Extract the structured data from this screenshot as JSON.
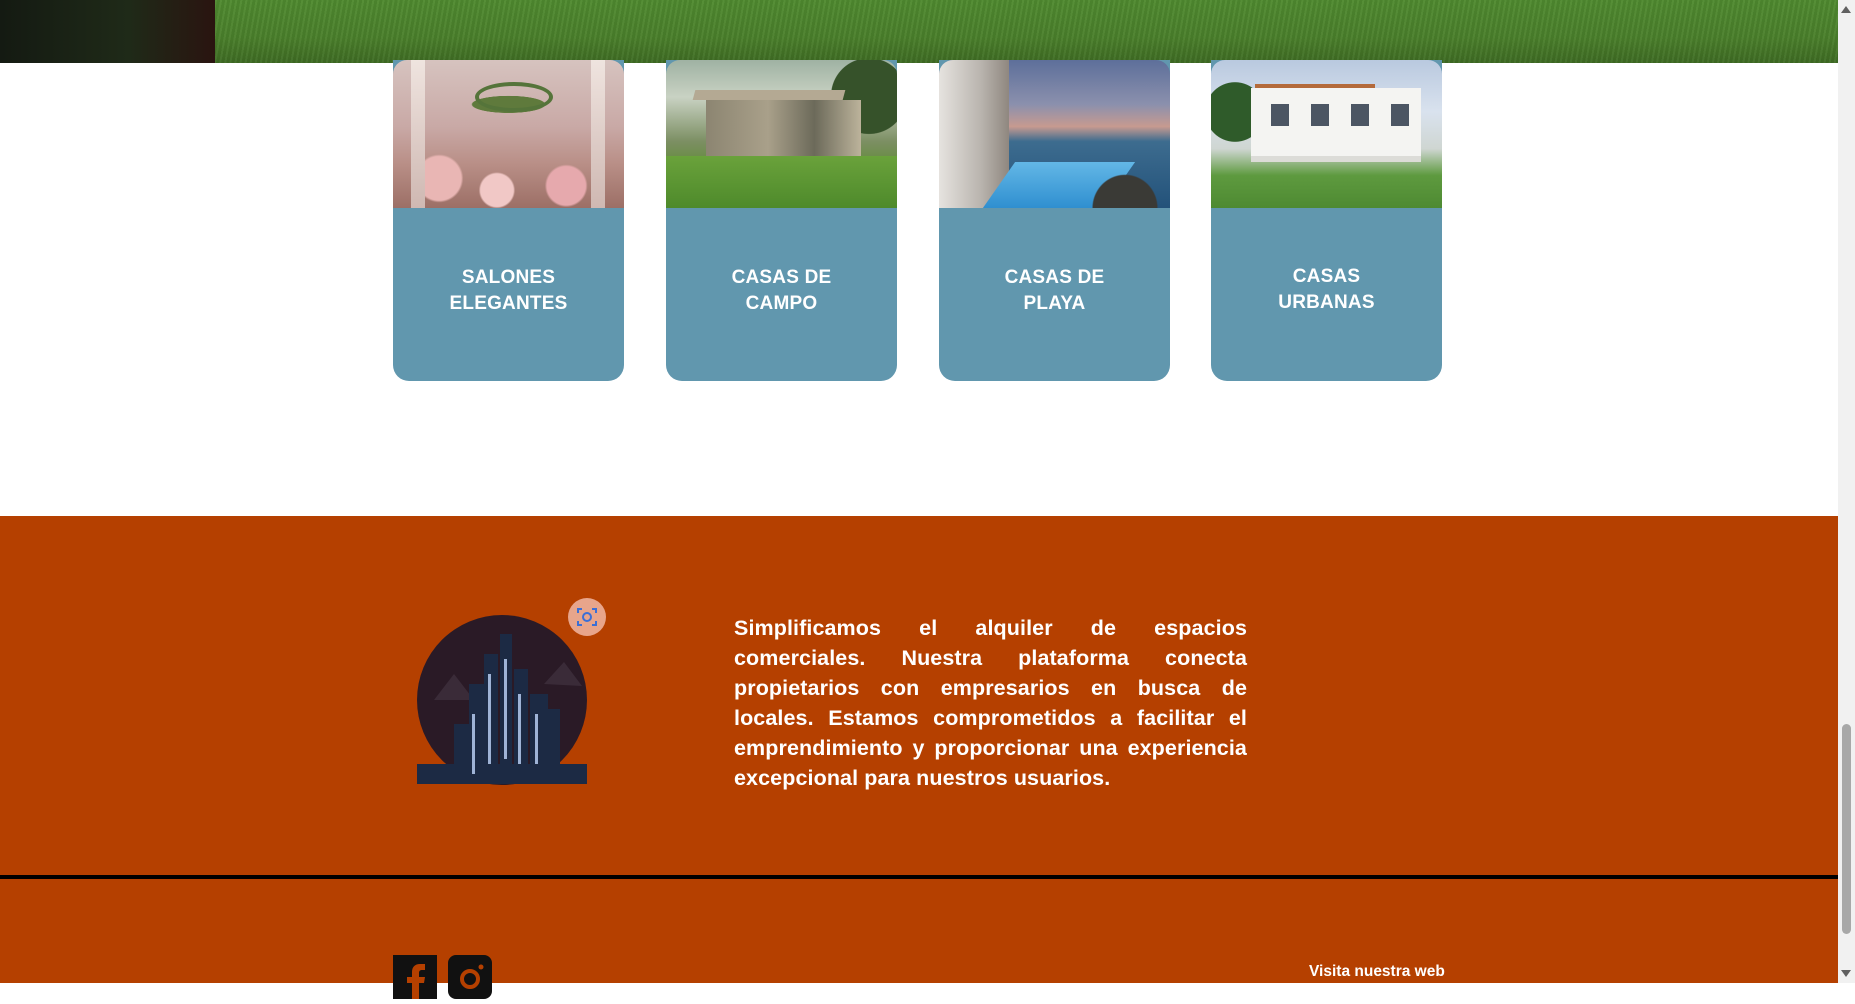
{
  "categories": [
    {
      "label": "SALONES\nELEGANTES",
      "image": "ballroom-photo"
    },
    {
      "label": "CASAS DE\nCAMPO",
      "image": "country-house-photo"
    },
    {
      "label": "CASAS DE\nPLAYA",
      "image": "beach-house-photo"
    },
    {
      "label": "CASAS\nURBANAS",
      "image": "urban-house-photo"
    }
  ],
  "footer": {
    "about": "Simplificamos el alquiler de espacios comerciales. Nuestra plataforma conecta propietarios con empresarios en busca de locales. Estamos comprometidos a facilitar el emprendimiento y proporcionar una experiencia excepcional para nuestros usuarios.",
    "visit_link": "Visita nuestra web",
    "social": [
      "facebook-icon",
      "instagram-icon"
    ]
  },
  "colors": {
    "card_bg": "#6197ae",
    "footer_bg": "#b54000",
    "badge_bg": "#e8a58b"
  }
}
